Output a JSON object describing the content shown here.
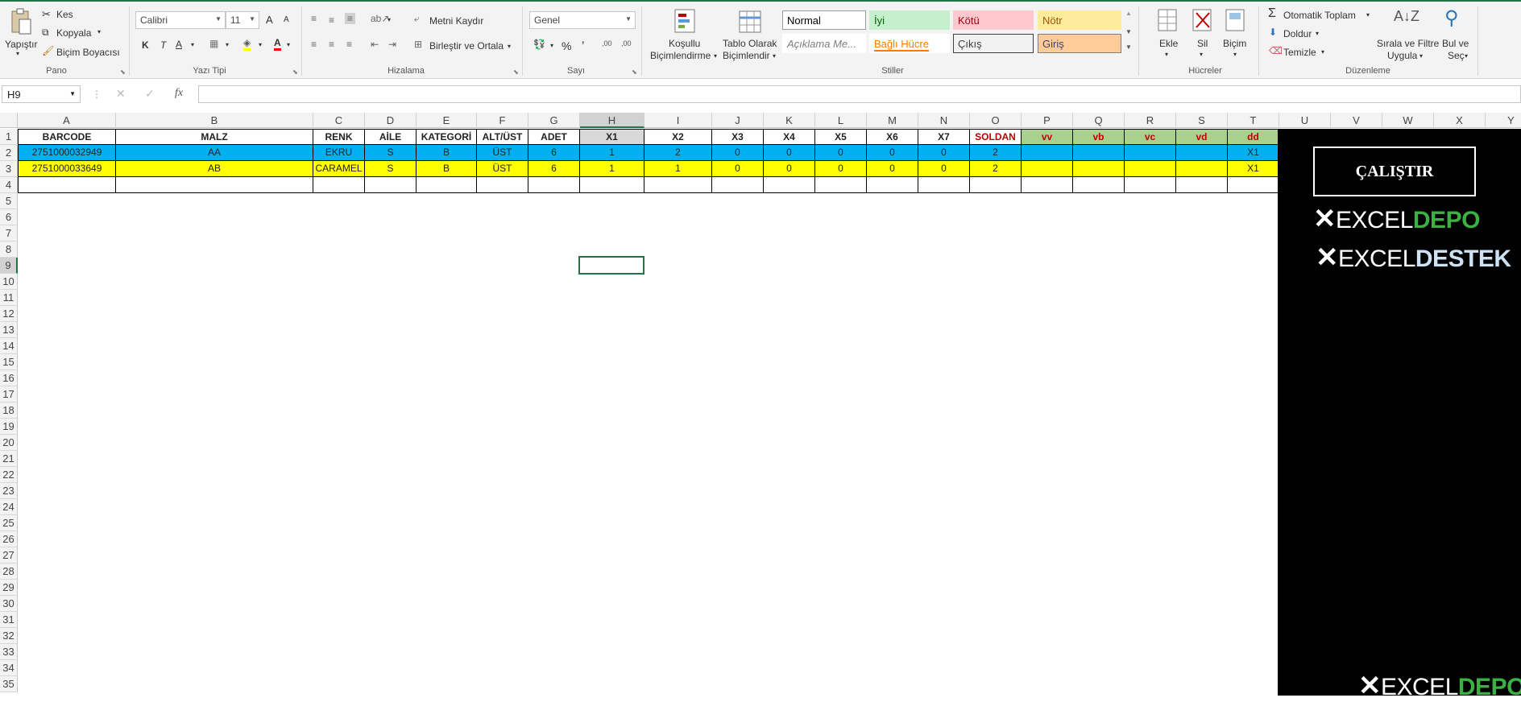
{
  "ribbon": {
    "clipboard": {
      "paste": "Yapıştır",
      "cut": "Kes",
      "copy": "Kopyala",
      "format_painter": "Biçim Boyacısı",
      "group": "Pano"
    },
    "font": {
      "name": "Calibri",
      "size": "11",
      "bold": "K",
      "italic": "T",
      "underline": "A",
      "font_color": "A",
      "grow": "A",
      "shrink": "A",
      "group": "Yazı Tipi"
    },
    "alignment": {
      "wrap": "Metni Kaydır",
      "merge": "Birleştir ve Ortala",
      "group": "Hizalama"
    },
    "number": {
      "format": "Genel",
      "percent": "%",
      "comma": "’",
      "inc_decimal": ",00",
      "dec_decimal": ",00",
      "group": "Sayı"
    },
    "styles": {
      "conditional": "Koşullu",
      "conditional2": "Biçimlendirme",
      "table": "Tablo Olarak",
      "table2": "Biçimlendir",
      "cells": [
        {
          "label": "Normal",
          "bg": "#ffffff",
          "color": "#000000",
          "border": "#9b9b9b"
        },
        {
          "label": "İyi",
          "bg": "#c6efce",
          "color": "#006100",
          "border": "#c6efce"
        },
        {
          "label": "Kötü",
          "bg": "#ffc7ce",
          "color": "#9c0006",
          "border": "#ffc7ce"
        },
        {
          "label": "Nötr",
          "bg": "#ffeb9c",
          "color": "#9c5700",
          "border": "#ffeb9c"
        },
        {
          "label": "Açıklama Me...",
          "bg": "#ffffff",
          "color": "#7f7f7f",
          "border": "#ffffff"
        },
        {
          "label": "Bağlı Hücre",
          "bg": "#ffffff",
          "color": "#fa7d00",
          "border": "#ffffff"
        },
        {
          "label": "Çıkış",
          "bg": "#f2f2f2",
          "color": "#3f3f3f",
          "border": "#3f3f3f"
        },
        {
          "label": "Giriş",
          "bg": "#ffcc99",
          "color": "#3f3f76",
          "border": "#7f7f7f"
        }
      ],
      "group": "Stiller"
    },
    "cells_group": {
      "insert": "Ekle",
      "delete": "Sil",
      "format": "Biçim",
      "group": "Hücreler"
    },
    "editing": {
      "autosum": "Otomatik Toplam",
      "fill": "Doldur",
      "clear": "Temizle",
      "sort": "Sırala ve Filtre",
      "sort2": "Uygula",
      "find": "Bul ve",
      "find2": "Seç",
      "group": "Düzenleme"
    }
  },
  "formula_bar": {
    "name_box": "H9",
    "fx": "fx",
    "formula": ""
  },
  "columns": [
    "A",
    "B",
    "C",
    "D",
    "E",
    "F",
    "G",
    "H",
    "I",
    "J",
    "K",
    "L",
    "M",
    "N",
    "O",
    "P",
    "Q",
    "R",
    "S",
    "T",
    "U",
    "V",
    "W",
    "X",
    "Y"
  ],
  "rows": [
    "1",
    "2",
    "3",
    "4",
    "5",
    "6",
    "7",
    "8",
    "9",
    "10",
    "11",
    "12",
    "13",
    "14",
    "15",
    "16",
    "17",
    "18",
    "19",
    "20",
    "21",
    "22",
    "23",
    "24",
    "25",
    "26",
    "27",
    "28",
    "29",
    "30",
    "31",
    "32",
    "33",
    "34",
    "35"
  ],
  "table": {
    "headers": [
      "BARCODE",
      "MALZ",
      "RENK",
      "AİLE",
      "KATEGORİ",
      "ALT/ÜST",
      "ADET",
      "X1",
      "X2",
      "X3",
      "X4",
      "X5",
      "X6",
      "X7",
      "SOLDAN",
      "vv",
      "vb",
      "vc",
      "vd",
      "dd"
    ],
    "rows": [
      [
        "2751000032949",
        "AA",
        "EKRU",
        "S",
        "B",
        "ÜST",
        "6",
        "1",
        "2",
        "0",
        "0",
        "0",
        "0",
        "0",
        "2",
        "",
        "",
        "",
        "",
        "X1"
      ],
      [
        "2751000033649",
        "AB",
        "CARAMEL",
        "S",
        "B",
        "ÜST",
        "6",
        "1",
        "1",
        "0",
        "0",
        "0",
        "0",
        "0",
        "2",
        "",
        "",
        "",
        "",
        "X1"
      ]
    ],
    "row_colors": [
      "#00b0f0",
      "#ffff00"
    ],
    "header_green": "#a9d08e",
    "header_red_text": "#c00000"
  },
  "panel": {
    "run_button": "ÇALIŞTIR",
    "logo1_a": "EXCEL",
    "logo1_b": "DEPO",
    "logo2_a": "EXCEL",
    "logo2_b": "DESTEK",
    "logo3_a": "EXCEL",
    "logo3_b": "DEPO",
    "green": "#3cb043",
    "light_blue": "#cfe2f3"
  }
}
